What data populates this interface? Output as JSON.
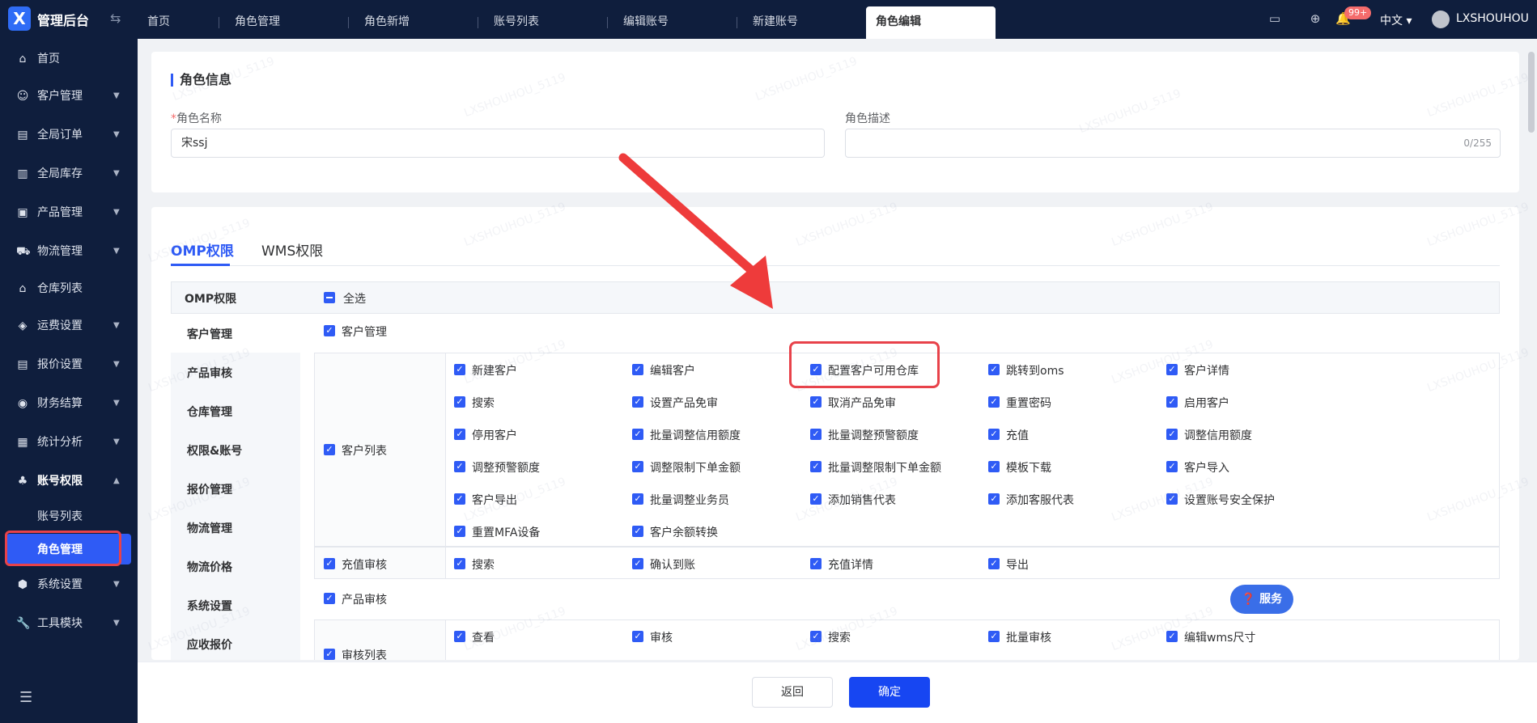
{
  "app": {
    "title": "管理后台",
    "logo_letter": "X"
  },
  "tabs": [
    {
      "label": "首页"
    },
    {
      "label": "角色管理"
    },
    {
      "label": "角色新增"
    },
    {
      "label": "账号列表"
    },
    {
      "label": "编辑账号"
    },
    {
      "label": "新建账号"
    },
    {
      "label": "角色编辑",
      "active": true
    }
  ],
  "topbar": {
    "badge": "99+",
    "language": "中文",
    "username": "LXSHOUHOU"
  },
  "sidebar": {
    "items": [
      {
        "label": "首页",
        "icon": "home-icon"
      },
      {
        "label": "客户管理",
        "icon": "users-icon"
      },
      {
        "label": "全局订单",
        "icon": "orders-icon"
      },
      {
        "label": "全局库存",
        "icon": "inventory-icon"
      },
      {
        "label": "产品管理",
        "icon": "product-icon"
      },
      {
        "label": "物流管理",
        "icon": "truck-icon"
      },
      {
        "label": "仓库列表",
        "icon": "warehouse-icon"
      },
      {
        "label": "运费设置",
        "icon": "shipping-icon"
      },
      {
        "label": "报价设置",
        "icon": "quote-icon"
      },
      {
        "label": "财务结算",
        "icon": "finance-icon"
      },
      {
        "label": "统计分析",
        "icon": "stats-icon"
      },
      {
        "label": "账号权限",
        "icon": "org-icon"
      },
      {
        "label": "系统设置",
        "icon": "settings-icon"
      },
      {
        "label": "工具模块",
        "icon": "tool-icon"
      }
    ],
    "sub_items": [
      {
        "label": "账号列表"
      },
      {
        "label": "角色管理",
        "active": true
      }
    ]
  },
  "role_info": {
    "title": "角色信息",
    "name_label": "角色名称",
    "name_required_mark": "*",
    "name_value": "宋ssj",
    "desc_label": "角色描述",
    "desc_counter": "0/255"
  },
  "permissions": {
    "tabs": [
      "OMP权限",
      "WMS权限"
    ],
    "header_label": "OMP权限",
    "select_all": "全选",
    "categories": [
      "客户管理",
      "产品审核",
      "仓库管理",
      "权限&账号",
      "报价管理",
      "物流管理",
      "物流价格",
      "系统设置",
      "应收报价"
    ],
    "customer_mgmt": "客户管理",
    "customer_list": {
      "label": "客户列表",
      "items": [
        "新建客户",
        "编辑客户",
        "配置客户可用仓库",
        "跳转到oms",
        "客户详情",
        "搜索",
        "设置产品免审",
        "取消产品免审",
        "重置密码",
        "启用客户",
        "停用客户",
        "批量调整信用额度",
        "批量调整预警额度",
        "充值",
        "调整信用额度",
        "调整预警额度",
        "调整限制下单金额",
        "批量调整限制下单金额",
        "模板下载",
        "客户导入",
        "客户导出",
        "批量调整业务员",
        "添加销售代表",
        "添加客服代表",
        "设置账号安全保护",
        "重置MFA设备",
        "客户余额转换"
      ]
    },
    "recharge_audit": {
      "label": "充值审核",
      "items": [
        "搜索",
        "确认到账",
        "充值详情",
        "导出"
      ]
    },
    "product_audit": "产品审核",
    "audit_list": {
      "label": "审核列表",
      "items": [
        "查看",
        "审核",
        "搜索",
        "批量审核",
        "编辑wms尺寸"
      ]
    }
  },
  "service_button": "服务",
  "footer": {
    "back": "返回",
    "confirm": "确定"
  },
  "watermark": "LXSHOUHOU_5119",
  "colors": {
    "primary": "#2f5bf5",
    "highlight": "#e8424a",
    "nav_bg": "#0f1e3d"
  }
}
